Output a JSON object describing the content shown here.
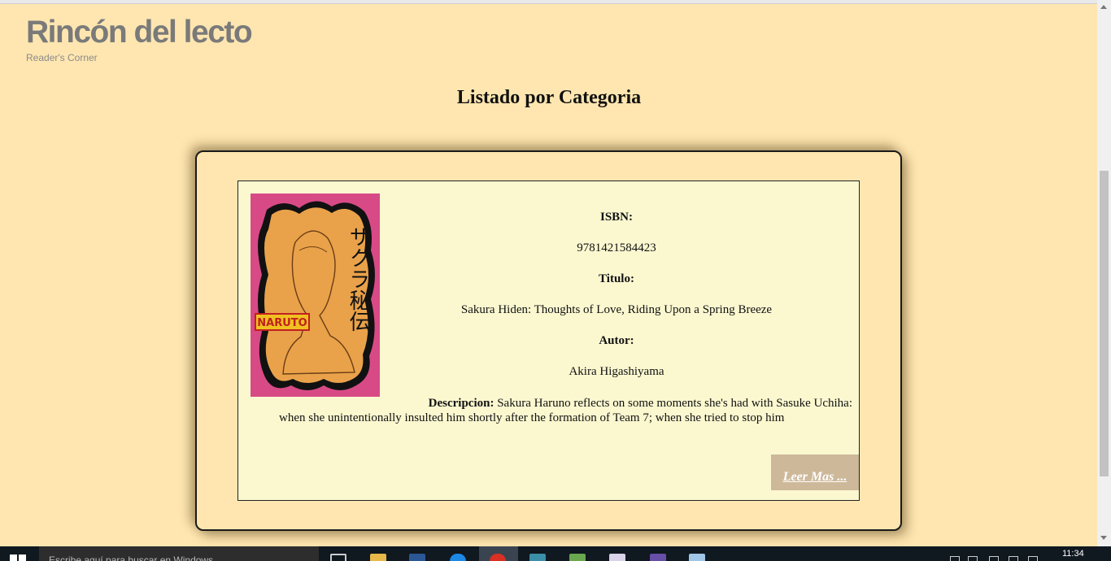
{
  "site": {
    "title": "Rincón del lecto",
    "subtitle": "Reader's Corner"
  },
  "page": {
    "heading": "Listado por Categoria"
  },
  "book": {
    "isbn_label": "ISBN:",
    "isbn": "9781421584423",
    "title_label": "Titulo:",
    "title": "Sakura Hiden: Thoughts of Love, Riding Upon a Spring Breeze",
    "author_label": "Autor:",
    "author": "Akira Higashiyama",
    "description_label": "Descripcion:",
    "description_line1": "Sakura Haruno reflects on some moments she's had with Sasuke Uchiha:",
    "description_line2": "when she unintentionally insulted him shortly after the formation of Team 7; when she tried to stop him",
    "read_more_label": "Leer Mas ...",
    "cover": {
      "title_text": "サクラ秘伝",
      "brand_text": "NARUTO",
      "colors": {
        "background": "#d84a86",
        "paper": "#e9a24a",
        "frame": "#111111"
      }
    }
  },
  "taskbar": {
    "search_placeholder": "Escribe aquí para buscar en Windows",
    "clock": "11:34"
  },
  "colors": {
    "page_background": "#ffe6b0",
    "card_background": "#fbf8d0",
    "button_background": "#cdb89a",
    "site_title": "#7a7a7a"
  }
}
